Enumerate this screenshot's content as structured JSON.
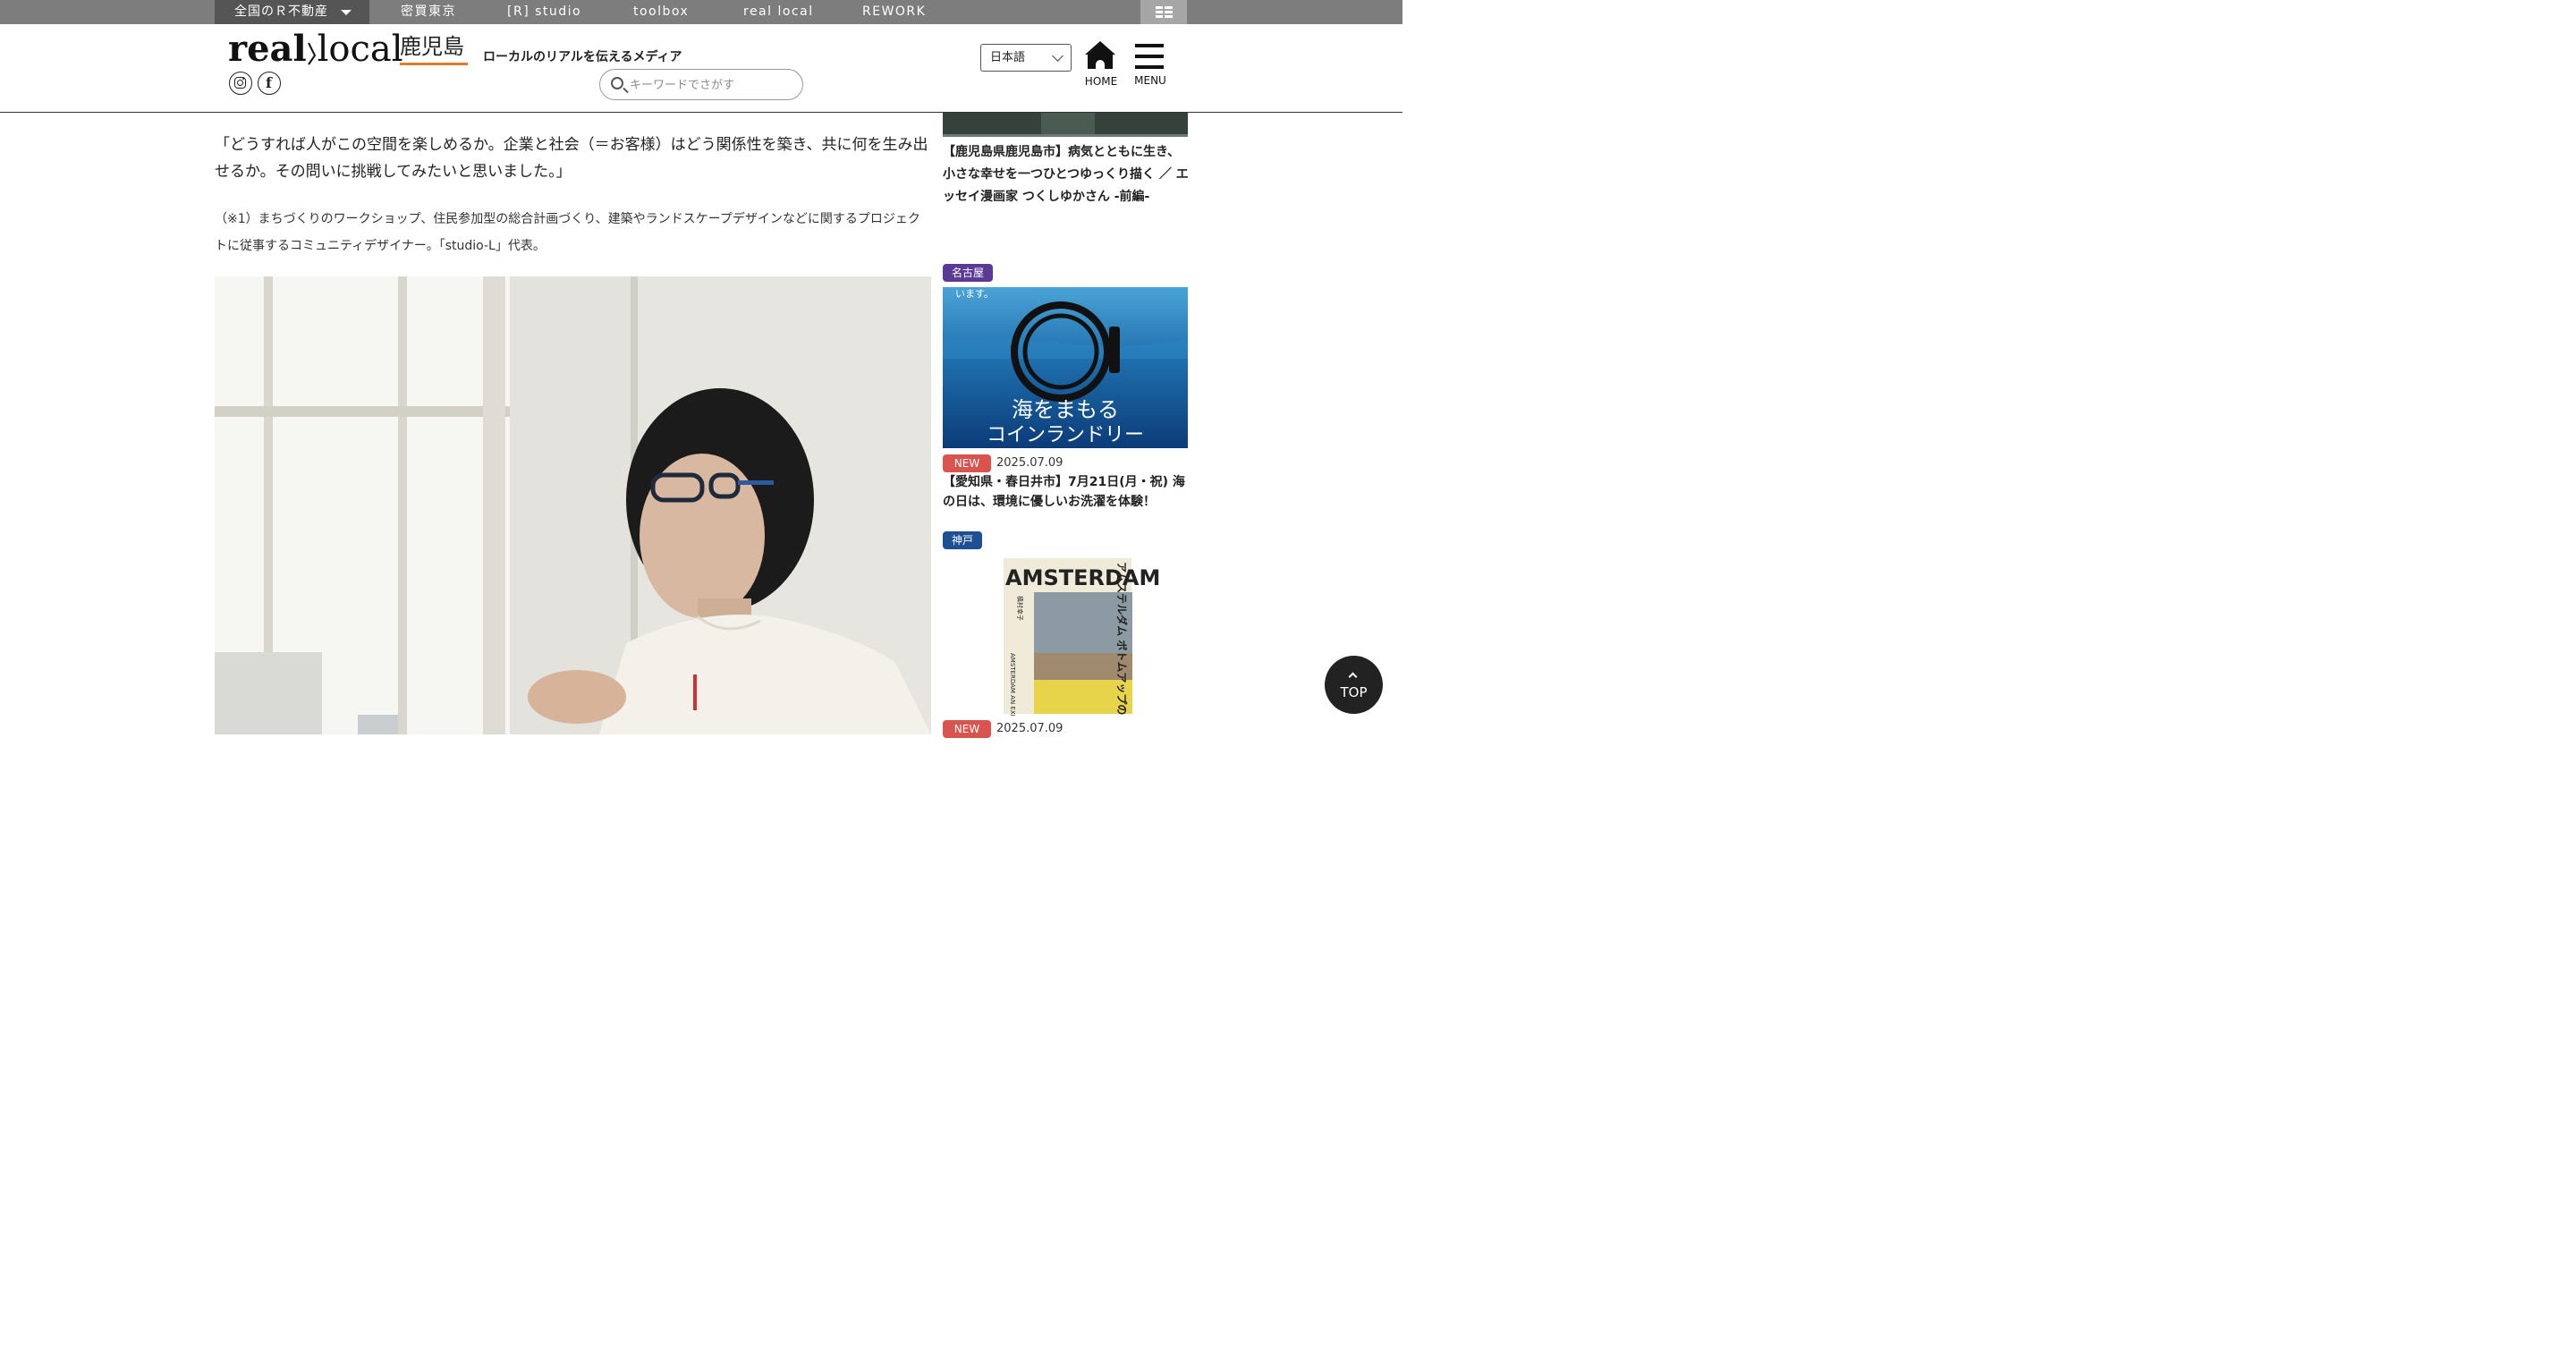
{
  "topbar": {
    "network_dropdown": "全国のＲ不動産",
    "links": [
      "密買東京",
      "[R] studio",
      "toolbox",
      "real local",
      "REWORK"
    ]
  },
  "header": {
    "logo_wordmark_a": "real",
    "logo_wordmark_b": "local",
    "logo_region": "鹿児島",
    "tagline": "ローカルのリアルを伝えるメディア",
    "search_placeholder": "キーワードでさがす",
    "language": "日本語",
    "home_label": "HOME",
    "menu_label": "MENU"
  },
  "article": {
    "quote": "「どうすれば人がこの空間を楽しめるか。企業と社会（＝お客様）はどう関係性を築き、共に何を生み出せるか。その問いに挑戦してみたいと思いました。」",
    "note": "（※1）まちづくりのワークショップ、住民参加型の総合計画づくり、建築やランドスケープデザインなどに関するプロジェクトに従事するコミュニティデザイナー。「studio-L」代表。"
  },
  "sidebar": {
    "items": [
      {
        "title": "【鹿児島県鹿児島市】病気とともに生き、小さな幸せを一つひとつゆっくり描く ／ エッセイ漫画家 つくしゆかさん -前編-"
      },
      {
        "category": "名古屋",
        "category_color": "#5b3a93",
        "image_text_top": "います。",
        "image_text_line1": "海をまもる",
        "image_text_line2": "コインランドリー",
        "badge": "NEW",
        "date": "2025.07.09",
        "title": "【愛知県・春日井市】7月21日(月・祝) 海の日は、環境に優しいお洗濯を体験！"
      },
      {
        "category": "神戸",
        "category_color": "#1e4f93",
        "book_title": "アムステルダム ボトムアップの実験都市",
        "book_author": "槙村幸子",
        "book_en": "AMSTERDAM AN EXPERIMENTAL CITY OF BOTTOM-UP DECISION",
        "book_logo": "AMSTERDAM",
        "badge": "NEW",
        "date": "2025.07.09"
      }
    ]
  },
  "to_top_label": "TOP",
  "colors": {
    "topbar": "#7d7d7d",
    "region_underline": "#e07b2a",
    "new_badge": "#d9534f"
  }
}
